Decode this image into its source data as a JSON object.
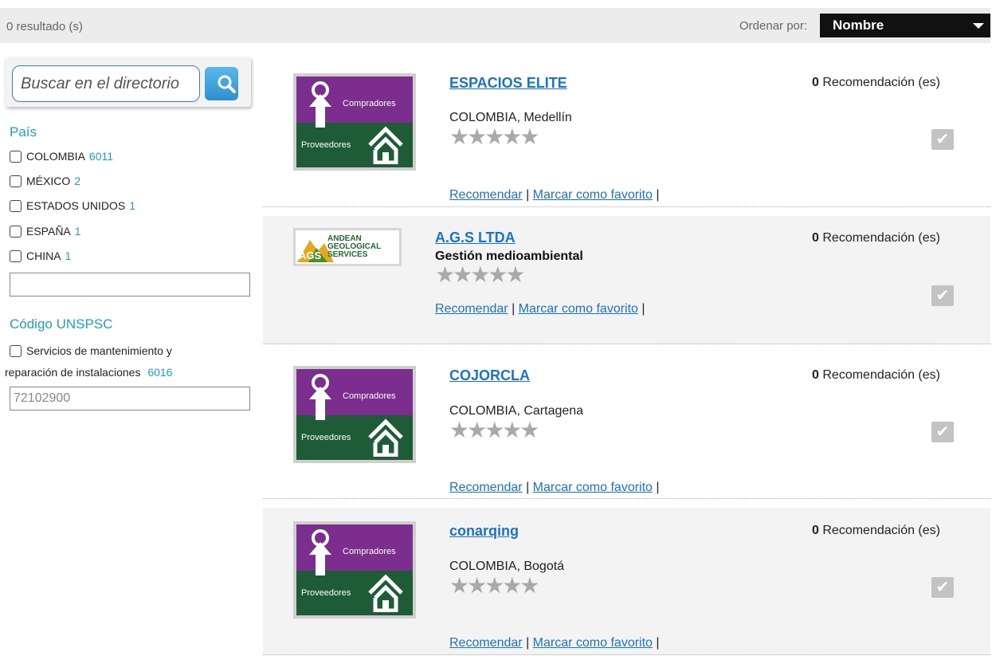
{
  "topbar": {
    "results_text": "0 resultado (s)",
    "sort_label": "Ordenar por:",
    "sort_value": "Nombre"
  },
  "sidebar": {
    "search_placeholder": "Buscar en el directorio",
    "country_title": "País",
    "countries": [
      {
        "name": "COLOMBIA",
        "count": "6011"
      },
      {
        "name": "MÉXICO",
        "count": "2"
      },
      {
        "name": "ESTADOS UNIDOS",
        "count": "1"
      },
      {
        "name": "ESPAÑA",
        "count": "1"
      },
      {
        "name": "CHINA",
        "count": "1"
      }
    ],
    "unspsc_title": "Código UNSPSC",
    "unspsc_item_line1": "Servicios de mantenimiento y",
    "unspsc_item_line2": "reparación de instalaciones",
    "unspsc_item_count": "6016",
    "unspsc_value": "72102900"
  },
  "results": [
    {
      "name": "ESPACIOS ELITE",
      "location": "COLOMBIA, Medellín",
      "rec_count": "0",
      "rec_label": "Recomendación (es)",
      "logo": "compradores-proveedores"
    },
    {
      "name": "A.G.S LTDA",
      "description": "Gestión medioambiental",
      "rec_count": "0",
      "rec_label": "Recomendación (es)",
      "logo": "andean-geological-services"
    },
    {
      "name": "COJORCLA",
      "location": "COLOMBIA, Cartagena",
      "rec_count": "0",
      "rec_label": "Recomendación (es)",
      "logo": "compradores-proveedores"
    },
    {
      "name": "conarqing",
      "location": "COLOMBIA, Bogotá",
      "rec_count": "0",
      "rec_label": "Recomendación (es)",
      "logo": "compradores-proveedores"
    }
  ],
  "logo_text": {
    "top": "Compradores",
    "bottom": "Proveedores",
    "ags_line1": "ANDEAN",
    "ags_line2": "GEOLOGICAL",
    "ags_line3": "SERVICES",
    "ags_mark": "AGS"
  },
  "actions": {
    "recommend": "Recomendar",
    "favorite": "Marcar como favorito",
    "sep": "|"
  },
  "stars": "★★★★★",
  "colors": {
    "accent": "#1f9ec5",
    "link": "#1a73c9",
    "purple": "#7b2e8e",
    "green": "#1e5b37",
    "sort_bg": "#111111"
  }
}
